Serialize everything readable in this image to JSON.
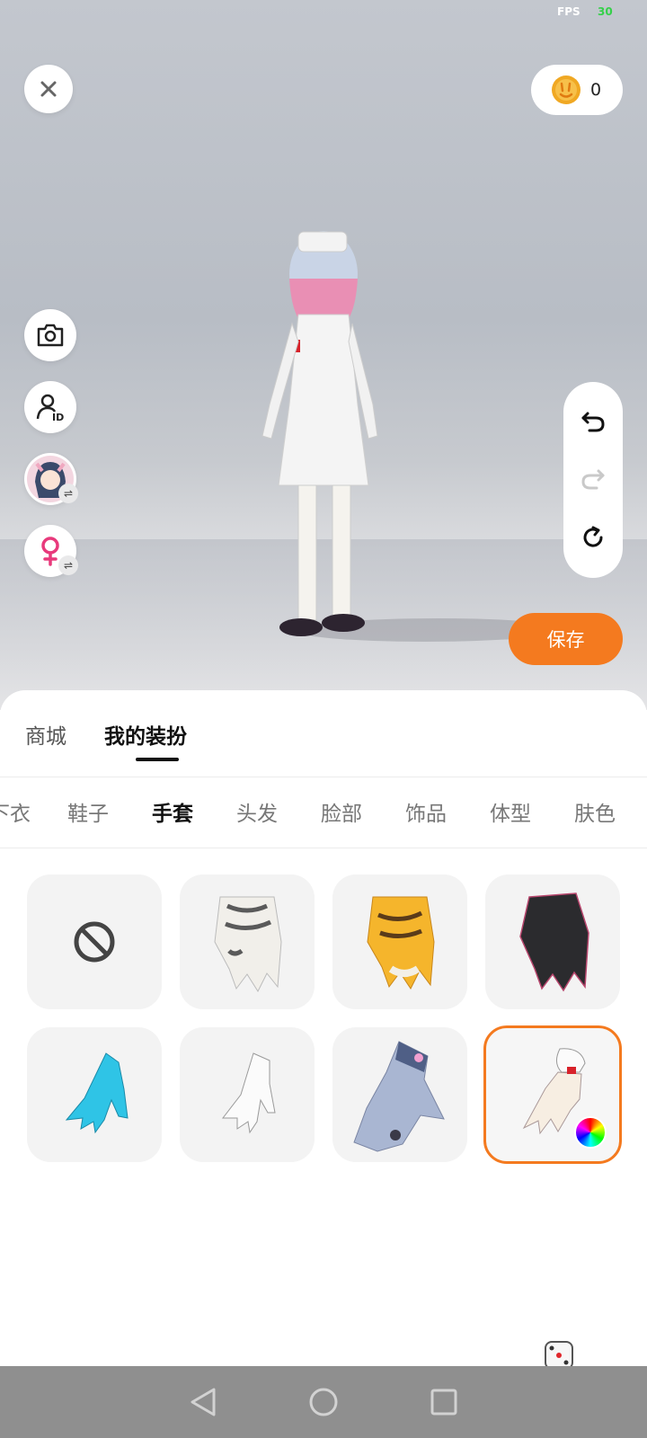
{
  "status": {
    "fps_label": "FPS",
    "fps_value": "30"
  },
  "header": {
    "coin_count": "0"
  },
  "actions": {
    "save_label": "保存",
    "random_label": "随机"
  },
  "main_tabs": [
    {
      "label": "商城",
      "active": false
    },
    {
      "label": "我的装扮",
      "active": true
    }
  ],
  "categories": [
    {
      "label": "下衣",
      "active": false
    },
    {
      "label": "鞋子",
      "active": false
    },
    {
      "label": "手套",
      "active": true
    },
    {
      "label": "头发",
      "active": false
    },
    {
      "label": "脸部",
      "active": false
    },
    {
      "label": "饰品",
      "active": false
    },
    {
      "label": "体型",
      "active": false
    },
    {
      "label": "肤色",
      "active": false
    }
  ],
  "items": [
    {
      "name": "none-icon"
    },
    {
      "name": "white-tiger-glove"
    },
    {
      "name": "yellow-tiger-glove"
    },
    {
      "name": "black-claw-glove"
    },
    {
      "name": "cyan-glove"
    },
    {
      "name": "white-glove"
    },
    {
      "name": "shark-glove"
    },
    {
      "name": "nurse-glove",
      "selected": true
    }
  ],
  "colors": {
    "accent": "#f47a1f",
    "navbar": "#8f8f8f"
  }
}
